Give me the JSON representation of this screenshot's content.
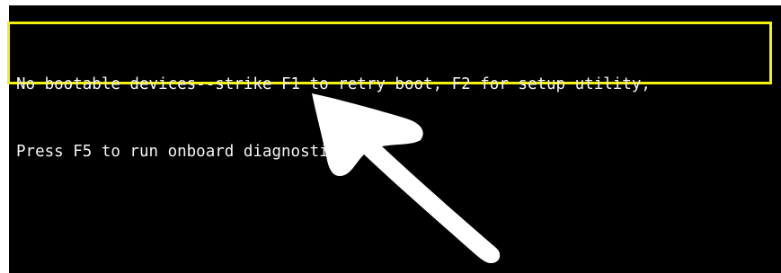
{
  "boot_screen": {
    "lines": [
      "No bootable devices--strike F1 to retry boot, F2 for setup utility,",
      "Press F5 to run onboard diagnostics"
    ]
  },
  "colors": {
    "screen_background": "#000000",
    "text": "#f4f4f4",
    "highlight_border": "#f2f20a",
    "arrow": "#ffffff"
  },
  "annotations": {
    "highlight": "yellow-box",
    "pointer": "white-arrow-icon"
  }
}
